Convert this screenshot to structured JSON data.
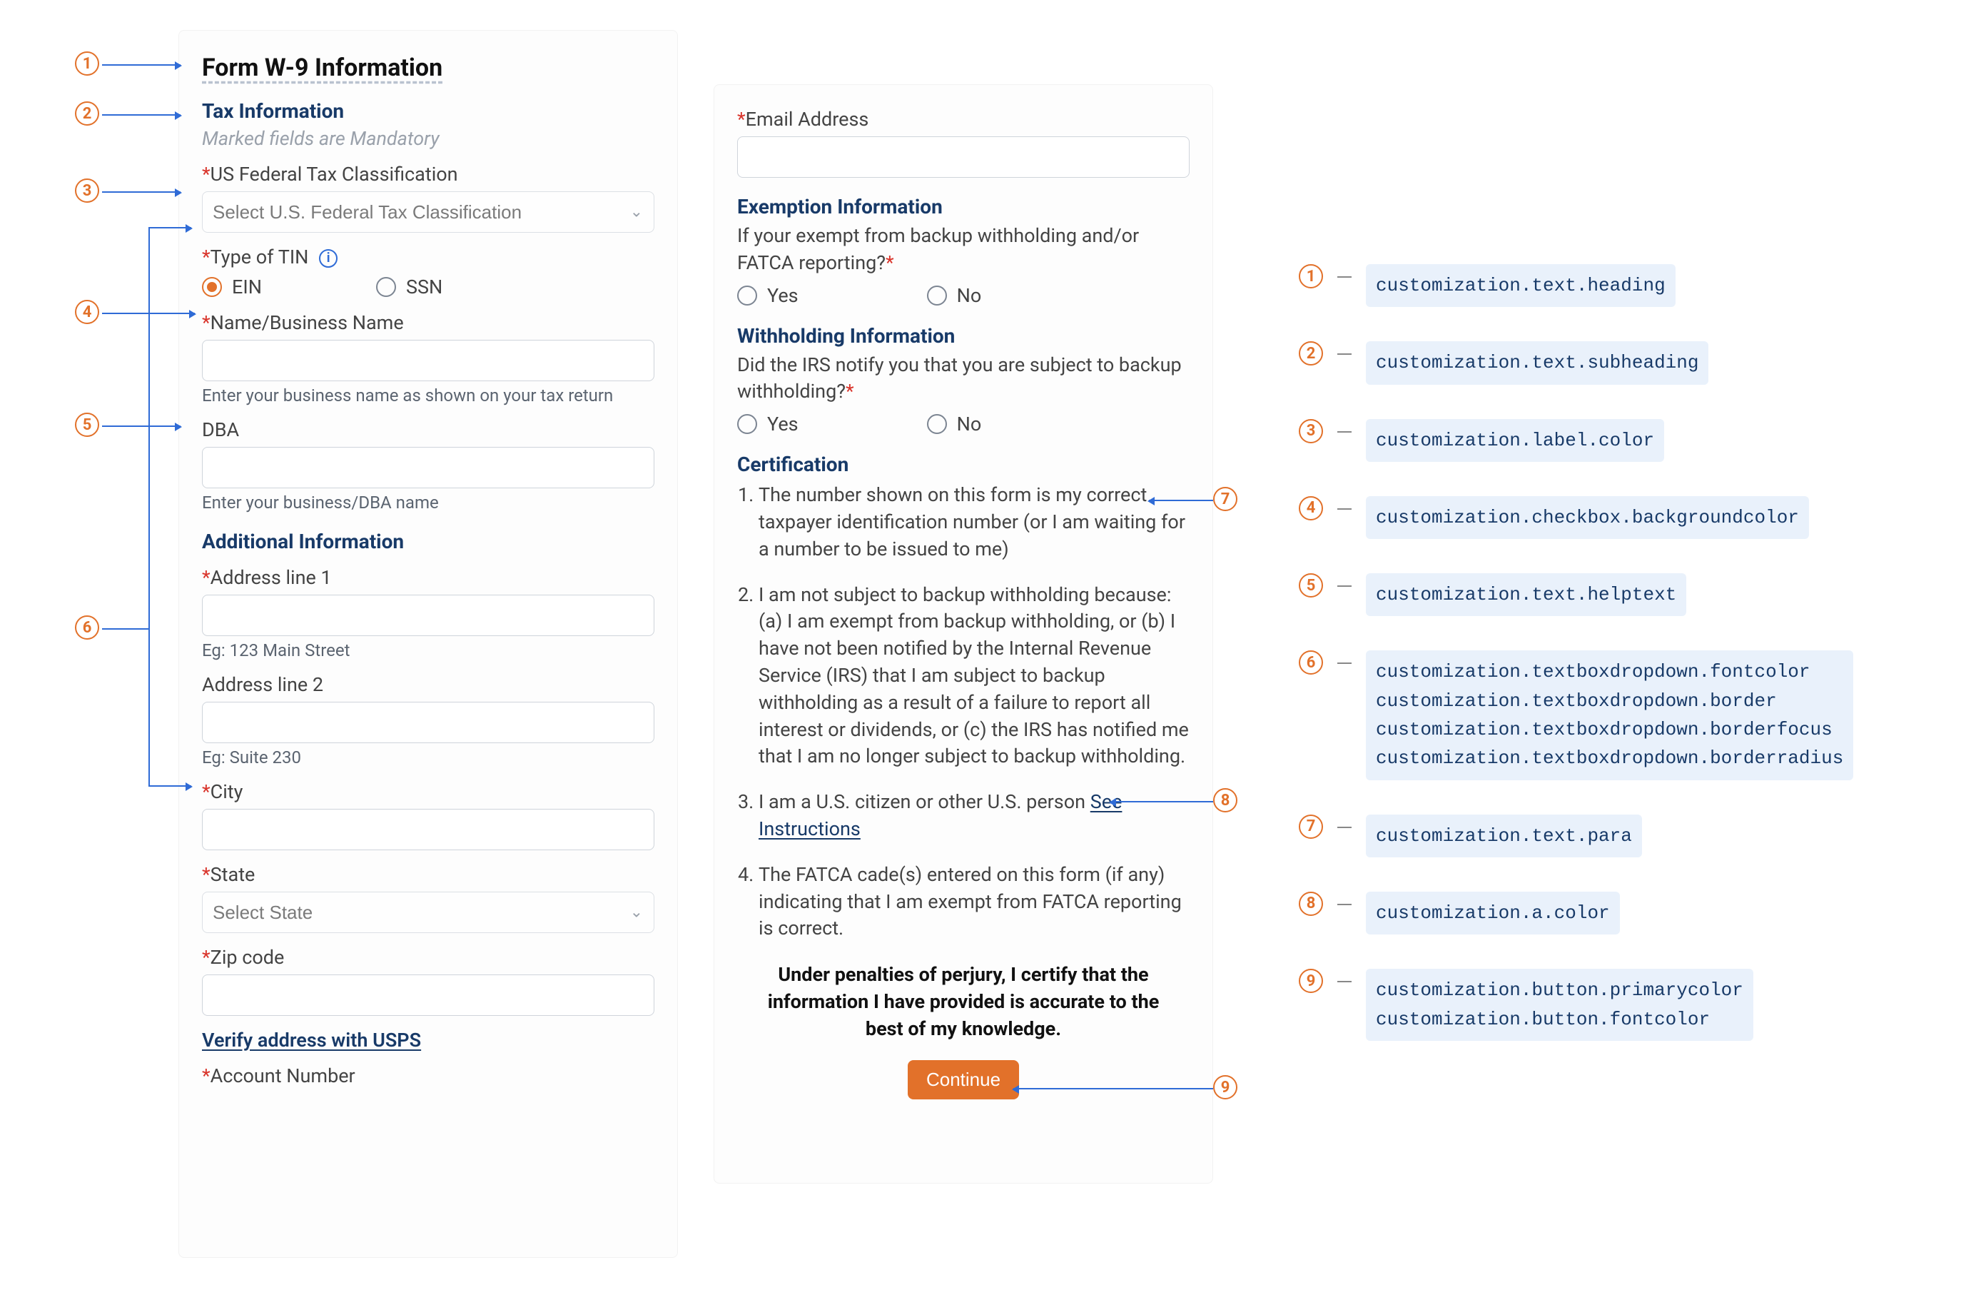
{
  "heading": "Form W-9 Information",
  "taxInfo": {
    "subheading": "Tax Information",
    "mandatoryNote": "Marked fields are Mandatory",
    "classification": {
      "label": "US Federal Tax Classification",
      "placeholder": "Select U.S. Federal Tax Classification"
    },
    "tinType": {
      "label": "Type of TIN",
      "optEin": "EIN",
      "optSsn": "SSN"
    },
    "businessName": {
      "label": "Name/Business Name",
      "help": "Enter your business name as shown on your tax return"
    },
    "dba": {
      "label": "DBA",
      "help": "Enter your business/DBA name"
    }
  },
  "addl": {
    "subheading": "Additional Information",
    "addr1": {
      "label": "Address line 1",
      "help": "Eg: 123 Main Street"
    },
    "addr2": {
      "label": "Address line 2",
      "help": "Eg: Suite 230"
    },
    "city": {
      "label": "City"
    },
    "state": {
      "label": "State",
      "placeholder": "Select State"
    },
    "zip": {
      "label": "Zip code"
    },
    "uspsLink": "Verify address with USPS",
    "account": {
      "label": "Account Number"
    },
    "email": {
      "label": "Email Address"
    }
  },
  "exemption": {
    "subheading": "Exemption Information",
    "question": "If your exempt from backup withholding and/or FATCA reporting?",
    "yes": "Yes",
    "no": "No"
  },
  "withholding": {
    "subheading": "Withholding Information",
    "question": "Did the IRS notify you that you are subject to backup withholding?",
    "yes": "Yes",
    "no": "No"
  },
  "cert": {
    "subheading": "Certification",
    "item1": "The number shown on this form is my correct taxpayer identification number (or I am waiting for a number to be issued to me)",
    "item2": "I am not subject to backup withholding because: (a) I am exempt from backup withholding, or (b) I have not been notified by the Internal Revenue Service (IRS) that I am subject to backup withholding as a result of a failure to report all interest or dividends, or (c) the IRS has notified me that I am no longer subject to backup withholding.",
    "item3Prefix": "I am a U.S. citizen or other U.S. person ",
    "item3Link": "See Instructions",
    "item4": "The FATCA cade(s) entered on this form (if any) indicating that I am exempt from FATCA reporting is correct.",
    "perjury": "Under penalties of perjury, I certify that the information I have provided is accurate to the best of my knowledge."
  },
  "continueLabel": "Continue",
  "docs": {
    "d1": "customization.text.heading",
    "d2": "customization.text.subheading",
    "d3": "customization.label.color",
    "d4": "customization.checkbox.backgroundcolor",
    "d5": "customization.text.helptext",
    "d6": "customization.textboxdropdown.fontcolor\ncustomization.textboxdropdown.border\ncustomization.textboxdropdown.borderfocus\ncustomization.textboxdropdown.borderradius",
    "d7": "customization.text.para",
    "d8": "customization.a.color",
    "d9": "customization.button.primarycolor\ncustomization.button.fontcolor"
  },
  "markers": {
    "m1": "1",
    "m2": "2",
    "m3": "3",
    "m4": "4",
    "m5": "5",
    "m6": "6",
    "m7": "7",
    "m8": "8",
    "m9": "9"
  }
}
